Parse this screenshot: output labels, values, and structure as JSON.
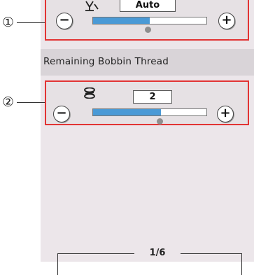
{
  "controls": [
    {
      "callout": "①",
      "icon": "thread-tension-icon",
      "value": "Auto",
      "minus_label": "−",
      "plus_label": "+",
      "level": 0.5
    },
    {
      "callout": "②",
      "icon": "bobbin-icon",
      "value": "2",
      "minus_label": "−",
      "plus_label": "+",
      "level": 0.6
    }
  ],
  "section_header": "Remaining Bobbin Thread",
  "page_indicator": "1/6",
  "colors": {
    "highlight_border": "#e23434",
    "slider_fill": "#4a9ad6",
    "panel_bg": "#ece6ea"
  }
}
